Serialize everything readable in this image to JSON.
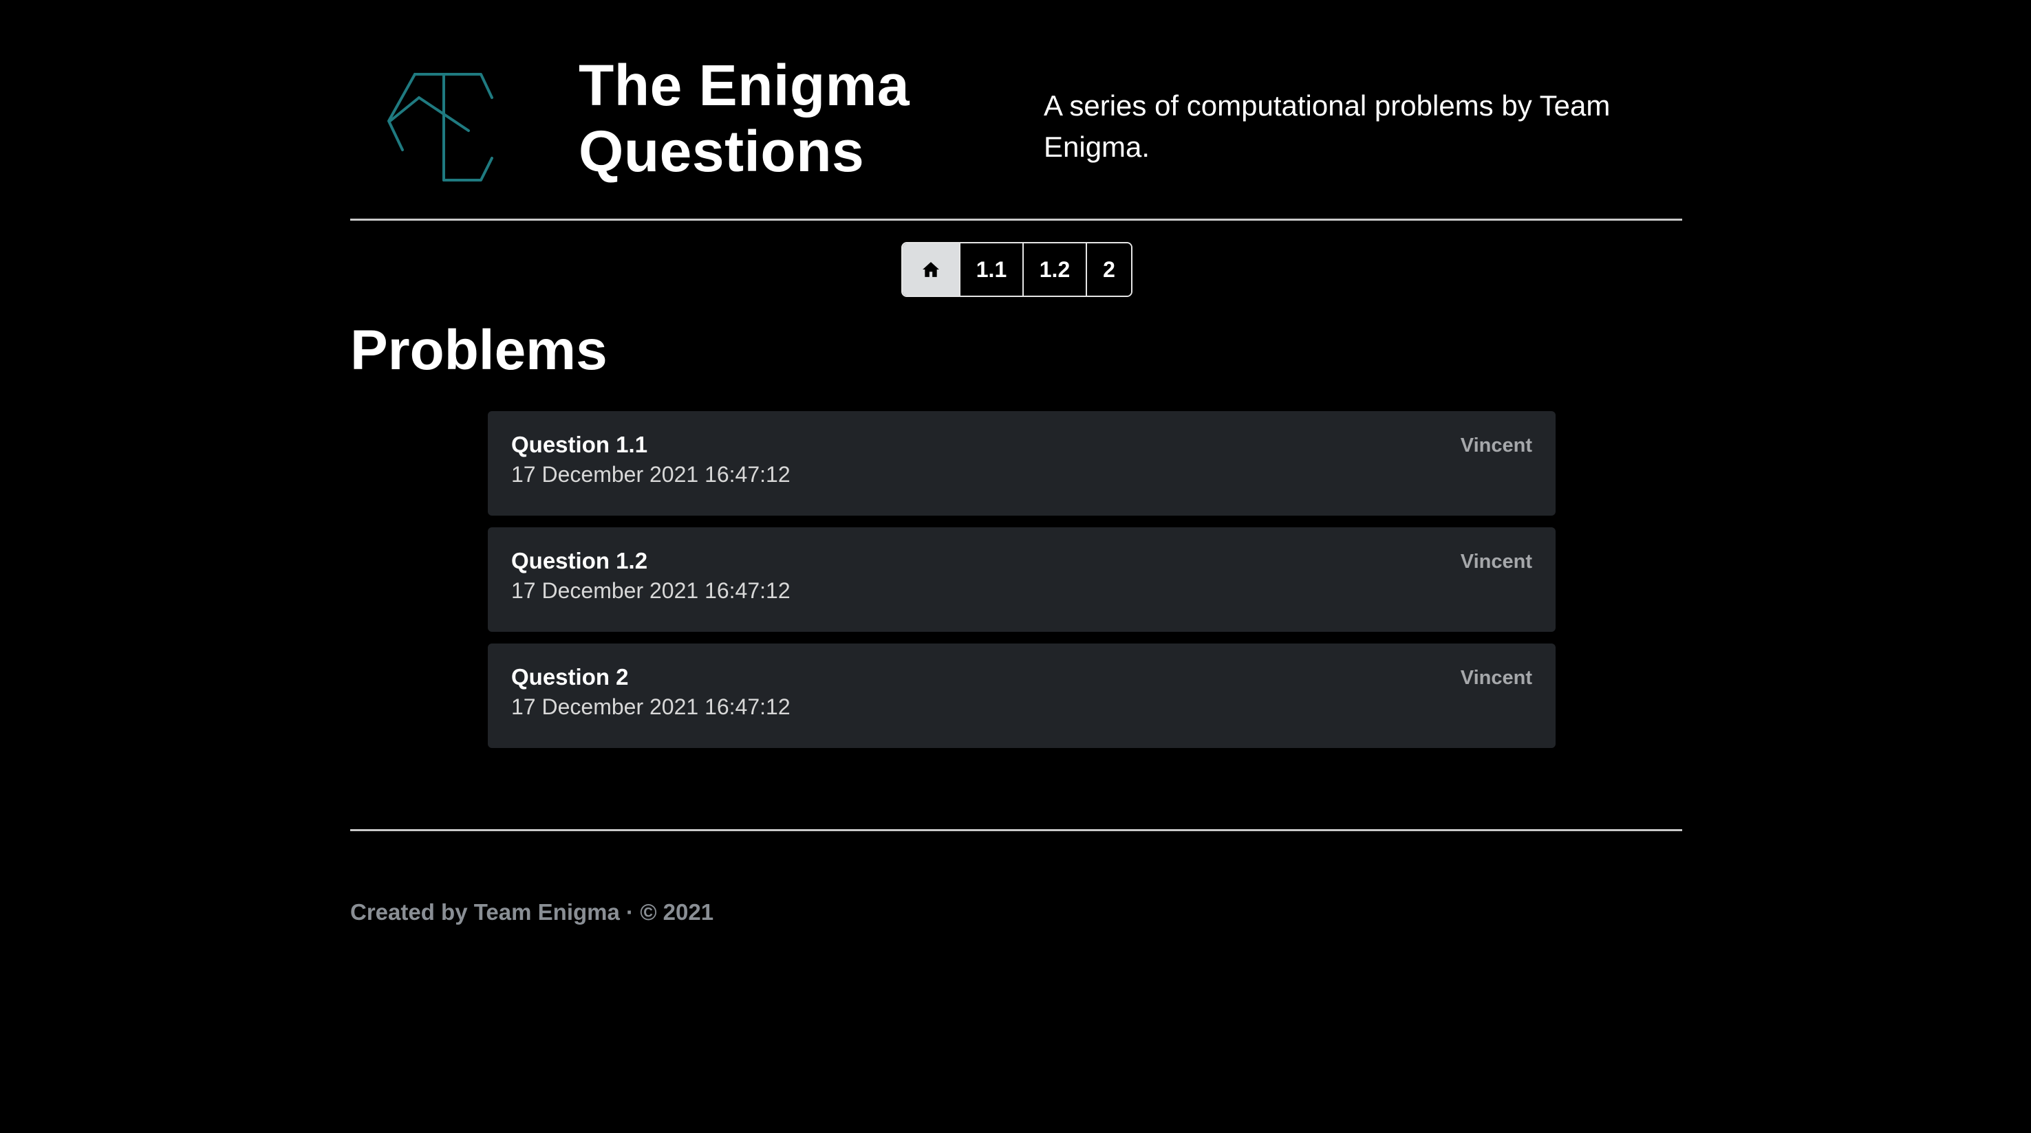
{
  "header": {
    "title_line1": "The Enigma",
    "title_line2": "Questions",
    "tagline": "A series of computational problems by Team Enigma.",
    "logo": "team-enigma-logo",
    "logo_color": "#1f7a80"
  },
  "nav": {
    "home_icon": "home-icon",
    "items": [
      {
        "label": "1.1"
      },
      {
        "label": "1.2"
      },
      {
        "label": "2"
      }
    ]
  },
  "main": {
    "section_title": "Problems",
    "problems": [
      {
        "title": "Question 1.1",
        "date": "17 December 2021 16:47:12",
        "author": "Vincent"
      },
      {
        "title": "Question 1.2",
        "date": "17 December 2021 16:47:12",
        "author": "Vincent"
      },
      {
        "title": "Question 2",
        "date": "17 December 2021 16:47:12",
        "author": "Vincent"
      }
    ]
  },
  "footer": {
    "created_by": "Created by Team Enigma",
    "separator": "·",
    "copyright": "© 2021"
  },
  "colors": {
    "background": "#000000",
    "card": "#212428",
    "footer_text": "#8a8f95",
    "author_text": "#a6a8ab"
  }
}
